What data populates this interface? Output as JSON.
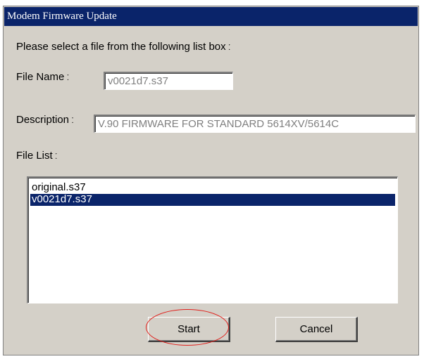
{
  "window": {
    "title": "Modem Firmware Update"
  },
  "instruction": "Please select a file from the following list box ː",
  "file_name": {
    "label": "File Name ː",
    "value": "v0021d7.s37"
  },
  "description": {
    "label": "Description ː",
    "value": "V.90 FIRMWARE FOR STANDARD 5614XV/5614C"
  },
  "file_list": {
    "label": "File List ː",
    "items": [
      "original.s37",
      "v0021d7.s37"
    ],
    "selected_index": 1
  },
  "buttons": {
    "start": "Start",
    "cancel": "Cancel"
  },
  "colors": {
    "title_bar": "#0a246a",
    "selection": "#0a246a",
    "dialog_face": "#d4d0c8",
    "annotation_circle": "#e0201c"
  }
}
